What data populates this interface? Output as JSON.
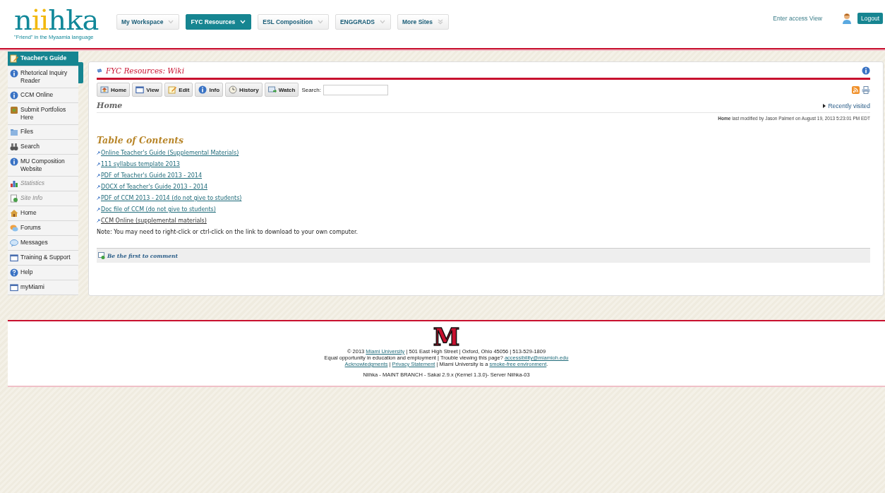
{
  "header": {
    "logo": "niihka",
    "tagline": "\"Friend\" in the Myaamia language",
    "sites": [
      {
        "label": "My Workspace",
        "selected": false
      },
      {
        "label": "FYC Resources",
        "selected": true
      },
      {
        "label": "ESL Composition",
        "selected": false
      },
      {
        "label": "ENGGRADS",
        "selected": false
      },
      {
        "label": "More Sites",
        "selected": false
      }
    ],
    "access_link": "Enter access View",
    "logout": "Logout"
  },
  "sidebar": {
    "items": [
      {
        "label": "Teacher's Guide",
        "selected": true,
        "disabled": false
      },
      {
        "label": "Rhetorical Inquiry Reader",
        "selected": false,
        "disabled": false
      },
      {
        "label": "CCM Online",
        "selected": false,
        "disabled": false
      },
      {
        "label": "Submit Portfolios Here",
        "selected": false,
        "disabled": false
      },
      {
        "label": "Files",
        "selected": false,
        "disabled": false
      },
      {
        "label": "Search",
        "selected": false,
        "disabled": false
      },
      {
        "label": "MU Composition Website",
        "selected": false,
        "disabled": false
      },
      {
        "label": "Statistics",
        "selected": false,
        "disabled": true
      },
      {
        "label": "Site Info",
        "selected": false,
        "disabled": true
      },
      {
        "label": "Home",
        "selected": false,
        "disabled": false
      },
      {
        "label": "Forums",
        "selected": false,
        "disabled": false
      },
      {
        "label": "Messages",
        "selected": false,
        "disabled": false
      },
      {
        "label": "Training & Support",
        "selected": false,
        "disabled": false
      },
      {
        "label": "Help",
        "selected": false,
        "disabled": false
      },
      {
        "label": "myMiami",
        "selected": false,
        "disabled": false
      }
    ]
  },
  "tool": {
    "title": "FYC Resources: Wiki",
    "toolbar": [
      {
        "label": "Home"
      },
      {
        "label": "View"
      },
      {
        "label": "Edit"
      },
      {
        "label": "Info"
      },
      {
        "label": "History"
      },
      {
        "label": "Watch"
      }
    ],
    "search_label": "Search:",
    "page_title": "Home",
    "recently_visited": "Recently visited",
    "modified": "**Home** last modified by Jason Palmeri on August 19, 2013 5:23:01 PM EDT",
    "toc_title": "Table of Contents",
    "links": [
      "Online Teacher's Guide (Supplemental Materials)",
      "111 syllabus template 2013",
      "PDF of Teacher's Guide 2013 - 2014",
      "DOCX of Teacher's Guide 2013 - 2014",
      "PDF of CCM 2013 - 2014 (do not give to students)",
      "Doc file of CCM (do not give to students)",
      "CCM Online (supplemental materials)"
    ],
    "note": "Note: You may need to right-click or ctrl-click on the link to download to your own computer.",
    "comment_link": "Be the first to comment"
  },
  "footer": {
    "logo": "M",
    "lines": [
      [
        {
          "text": "© 2013 ",
          "link": false
        },
        {
          "text": "Miami University",
          "link": true
        },
        {
          "text": " | 501 East High Street | Oxford, Ohio 45056 | 513-529-1809",
          "link": false
        }
      ],
      [
        {
          "text": "Equal opportunity in education and employment | Trouble viewing this page? ",
          "link": false
        },
        {
          "text": "accessibility@miamioh.edu",
          "link": true
        }
      ],
      [
        {
          "text": "Acknowledgments",
          "link": true
        },
        {
          "text": " | ",
          "link": false
        },
        {
          "text": "Privacy Statement",
          "link": true
        },
        {
          "text": " | Miami University is a ",
          "link": false
        },
        {
          "text": "smoke-free environment",
          "link": true
        },
        {
          "text": ".",
          "link": false
        }
      ]
    ],
    "version": "Niihka - MAINT BRANCH - Sakai 2.9.x (Kernel 1.3.0)- Server Niihka-03"
  }
}
